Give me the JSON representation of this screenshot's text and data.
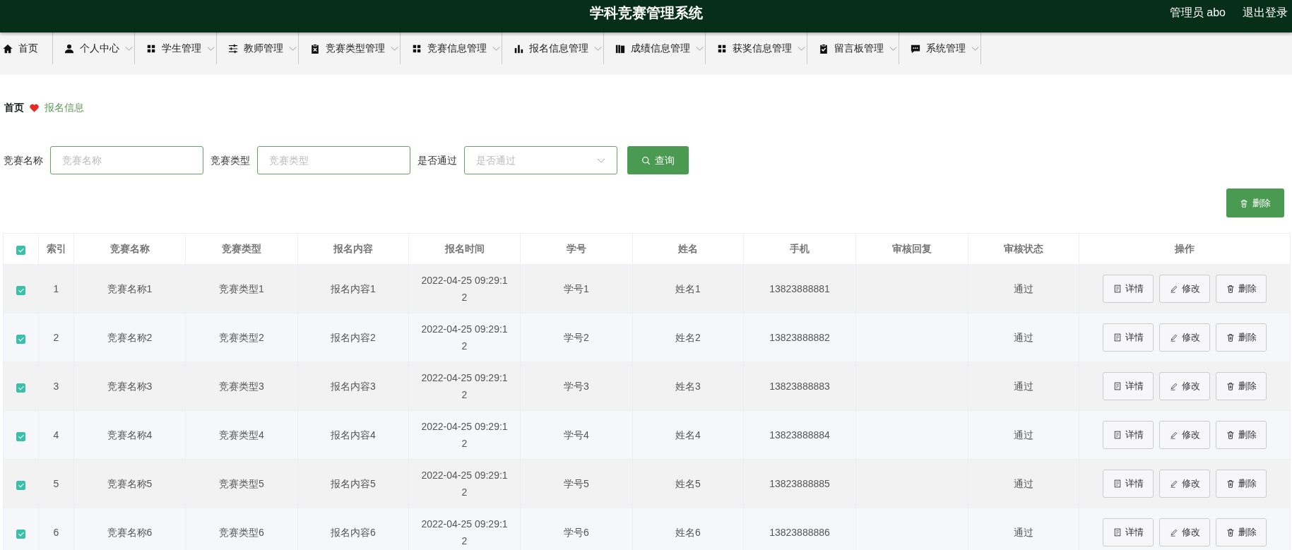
{
  "header": {
    "title": "学科竞赛管理系统",
    "user": "管理员 abo",
    "logout": "退出登录"
  },
  "nav": [
    {
      "label": "首页",
      "kind": "link"
    },
    {
      "label": "个人中心",
      "kind": "dropdown"
    },
    {
      "label": "学生管理",
      "kind": "dropdown"
    },
    {
      "label": "教师管理",
      "kind": "dropdown"
    },
    {
      "label": "竞赛类型管理",
      "kind": "dropdown"
    },
    {
      "label": "竞赛信息管理",
      "kind": "dropdown"
    },
    {
      "label": "报名信息管理",
      "kind": "dropdown"
    },
    {
      "label": "成绩信息管理",
      "kind": "dropdown"
    },
    {
      "label": "获奖信息管理",
      "kind": "dropdown"
    },
    {
      "label": "留言板管理",
      "kind": "dropdown"
    },
    {
      "label": "系统管理",
      "kind": "dropdown"
    }
  ],
  "breadcrumb": {
    "home": "首页",
    "current": "报名信息"
  },
  "search": {
    "fields": [
      {
        "label": "竞赛名称",
        "placeholder": "竞赛名称",
        "kind": "input"
      },
      {
        "label": "竞赛类型",
        "placeholder": "竞赛类型",
        "kind": "input"
      },
      {
        "label": "是否通过",
        "placeholder": "是否通过",
        "kind": "select"
      }
    ],
    "button": "查询"
  },
  "delete_button": "删除",
  "table": {
    "all_selected": true,
    "columns": [
      "索引",
      "竞赛名称",
      "竞赛类型",
      "报名内容",
      "报名时间",
      "学号",
      "姓名",
      "手机",
      "审核回复",
      "审核状态",
      "操作"
    ],
    "rows": [
      {
        "selected": true,
        "cells": [
          "1",
          "竞赛名称1",
          "竞赛类型1",
          "报名内容1",
          "2022-04-25 09:29:12",
          "学号1",
          "姓名1",
          "13823888881",
          "",
          "通过"
        ],
        "actions": [
          "详情",
          "修改",
          "删除"
        ]
      },
      {
        "selected": true,
        "cells": [
          "2",
          "竞赛名称2",
          "竞赛类型2",
          "报名内容2",
          "2022-04-25 09:29:12",
          "学号2",
          "姓名2",
          "13823888882",
          "",
          "通过"
        ],
        "actions": [
          "详情",
          "修改",
          "删除"
        ]
      },
      {
        "selected": true,
        "cells": [
          "3",
          "竞赛名称3",
          "竞赛类型3",
          "报名内容3",
          "2022-04-25 09:29:12",
          "学号3",
          "姓名3",
          "13823888883",
          "",
          "通过"
        ],
        "actions": [
          "详情",
          "修改",
          "删除"
        ]
      },
      {
        "selected": true,
        "cells": [
          "4",
          "竞赛名称4",
          "竞赛类型4",
          "报名内容4",
          "2022-04-25 09:29:12",
          "学号4",
          "姓名4",
          "13823888884",
          "",
          "通过"
        ],
        "actions": [
          "详情",
          "修改",
          "删除"
        ]
      },
      {
        "selected": true,
        "cells": [
          "5",
          "竞赛名称5",
          "竞赛类型5",
          "报名内容5",
          "2022-04-25 09:29:12",
          "学号5",
          "姓名5",
          "13823888885",
          "",
          "通过"
        ],
        "actions": [
          "详情",
          "修改",
          "删除"
        ]
      },
      {
        "selected": true,
        "cells": [
          "6",
          "竞赛名称6",
          "竞赛类型6",
          "报名内容6",
          "2022-04-25 09:29:12",
          "学号6",
          "姓名6",
          "13823888886",
          "",
          "通过"
        ],
        "actions": [
          "详情",
          "修改",
          "删除"
        ]
      }
    ]
  }
}
